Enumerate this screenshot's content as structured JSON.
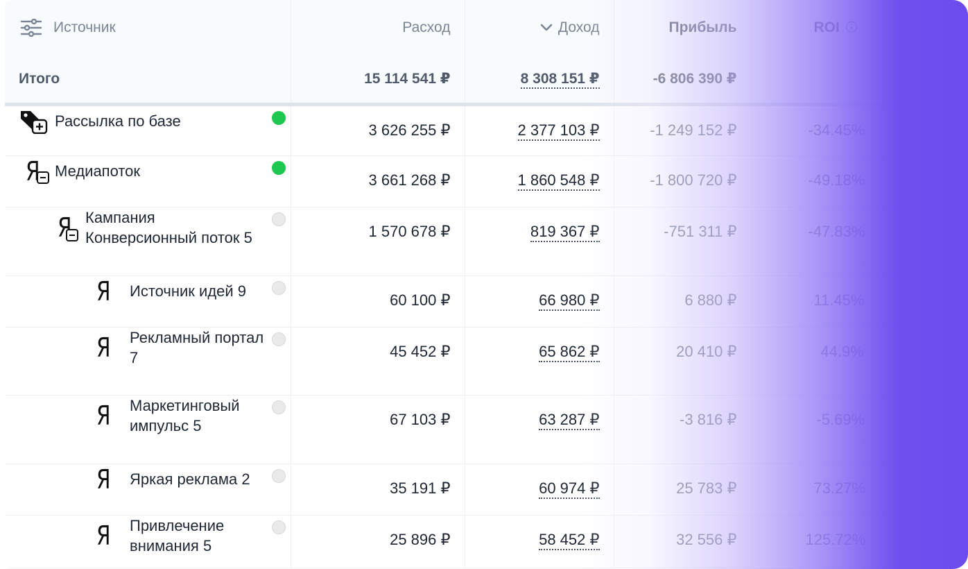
{
  "header": {
    "source_label": "Источник",
    "expense_label": "Расход",
    "income_label": "Доход",
    "profit_label": "Прибыль",
    "roi_label": "ROI"
  },
  "totals": {
    "label": "Итого",
    "expense": "15 114 541 ₽",
    "income": "8 308 151 ₽",
    "profit": "-6 806 390 ₽",
    "roi": ""
  },
  "rows": [
    {
      "name": "Рассылка по базе",
      "icon": "tag-plus-icon",
      "status": "active",
      "expense": "3 626 255 ₽",
      "income": "2 377 103 ₽",
      "profit": "-1 249 152 ₽",
      "roi": "-34.45%"
    },
    {
      "name": "Медиапоток",
      "icon": "yandex-collapse-icon",
      "status": "active",
      "expense": "3 661 268 ₽",
      "income": "1 860 548 ₽",
      "profit": "-1 800 720 ₽",
      "roi": "-49.18%"
    },
    {
      "name_line1": "Кампания",
      "name_line2": "Конверсионный поток 5",
      "icon": "yandex-collapse-icon",
      "status": "inactive",
      "expense": "1 570 678 ₽",
      "income": "819 367 ₽",
      "profit": "-751 311 ₽",
      "roi": "-47.83%"
    },
    {
      "name": "Источник идей 9",
      "icon": "yandex-icon",
      "status": "inactive",
      "expense": "60 100 ₽",
      "income": "66 980 ₽",
      "profit": "6 880 ₽",
      "roi": "11.45%"
    },
    {
      "name_line1": "Рекламный портал",
      "name_line2": "7",
      "icon": "yandex-icon",
      "status": "inactive",
      "expense": "45 452 ₽",
      "income": "65 862 ₽",
      "profit": "20 410 ₽",
      "roi": "44.9%"
    },
    {
      "name_line1": "Маркетинговый",
      "name_line2": "импульс 5",
      "icon": "yandex-icon",
      "status": "inactive",
      "expense": "67 103 ₽",
      "income": "63 287 ₽",
      "profit": "-3 816 ₽",
      "roi": "-5.69%"
    },
    {
      "name": "Яркая реклама 2",
      "icon": "yandex-icon",
      "status": "inactive",
      "expense": "35 191 ₽",
      "income": "60 974 ₽",
      "profit": "25 783 ₽",
      "roi": "73.27%"
    },
    {
      "name_line1": "Привлечение",
      "name_line2": "внимания 5",
      "icon": "yandex-icon",
      "status": "inactive",
      "expense": "25 896 ₽",
      "income": "58 452 ₽",
      "profit": "32 556 ₽",
      "roi": "125.72%"
    }
  ],
  "icons": {
    "yandex_glyph": "Я"
  },
  "colors": {
    "status_active": "#1ec74f",
    "status_inactive": "#eaeaea",
    "gradient_end": "#6c4cee"
  }
}
